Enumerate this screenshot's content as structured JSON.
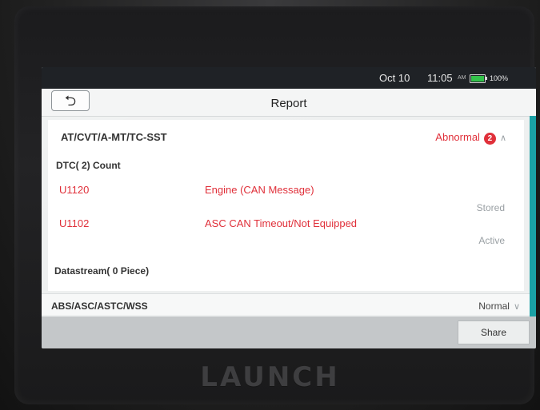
{
  "status_bar": {
    "date": "Oct 10",
    "time": "11:05",
    "ampm": "AM",
    "battery": "100%",
    "battery_color": "#33c24a"
  },
  "header": {
    "title": "Report",
    "back_icon": "back-arrow-icon"
  },
  "systems": [
    {
      "name": "AT/CVT/A-MT/TC-SST",
      "status": "Abnormal",
      "count": "2",
      "dtc_count_label": "DTC( 2) Count",
      "dtcs": [
        {
          "code": "U1120",
          "description": "Engine (CAN Message)",
          "state": "Stored"
        },
        {
          "code": "U1102",
          "description": "ASC CAN Timeout/Not Equipped",
          "state": "Active"
        }
      ],
      "datastream_label": "Datastream( 0 Piece)"
    },
    {
      "name": "ABS/ASC/ASTC/WSS",
      "status": "Normal"
    }
  ],
  "footer": {
    "share_label": "Share"
  },
  "device_brand": "LAUNCH",
  "colors": {
    "accent": "#1aa1a6",
    "abnormal": "#e0303a",
    "status_bar_bg": "#1f2226"
  }
}
